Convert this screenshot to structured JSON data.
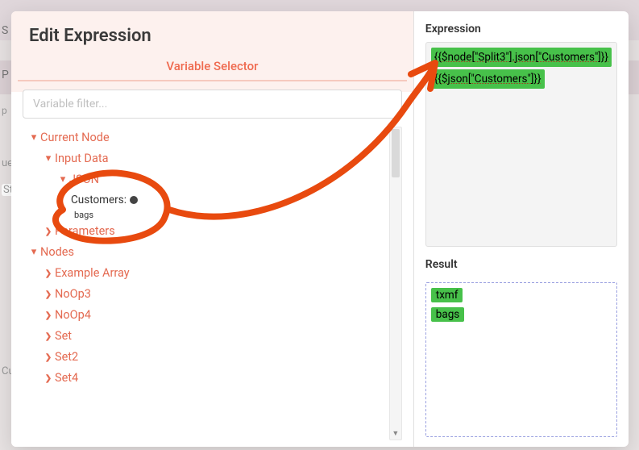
{
  "modal": {
    "title": "Edit Expression",
    "selector_label": "Variable Selector",
    "filter_placeholder": "Variable filter..."
  },
  "tree": {
    "current_node": {
      "label": "Current Node"
    },
    "input_data_label": "Input Data",
    "json_label": "JSON",
    "json_item_key": "Customers:",
    "json_item_val": "bags",
    "parameters_label": "Parameters",
    "nodes_label": "Nodes",
    "nodes": [
      "Example Array",
      "NoOp3",
      "NoOp4",
      "Set",
      "Set2",
      "Set4"
    ]
  },
  "right": {
    "expression_label": "Expression",
    "expressions": [
      "{{$node[\"Split3\"].json[\"Customers\"]}}",
      "{{$json[\"Customers\"]}}"
    ],
    "result_label": "Result",
    "results": [
      "txmf",
      "bags"
    ]
  },
  "background": {
    "s_letter": "S",
    "p_letter": "P",
    "p_sub": "p",
    "ue": "ue",
    "st": "St",
    "cu": "Cu"
  }
}
